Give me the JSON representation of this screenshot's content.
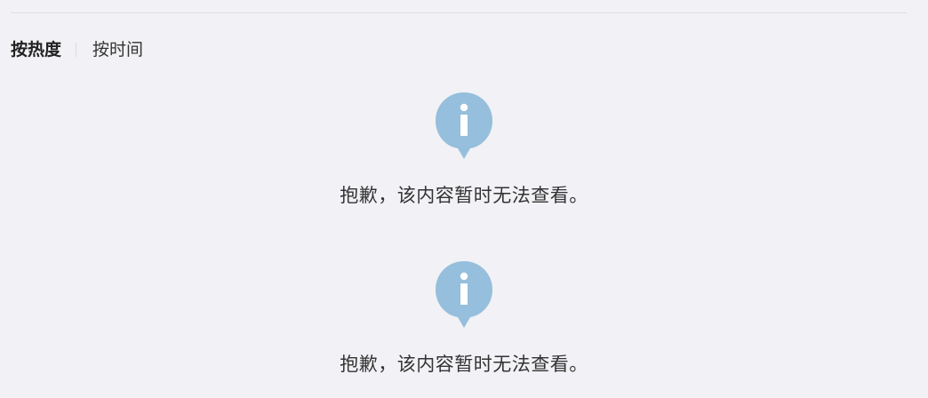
{
  "sort": {
    "tabs": [
      {
        "label": "按热度",
        "active": true
      },
      {
        "label": "按时间",
        "active": false
      }
    ]
  },
  "notices": [
    {
      "icon": "info-icon",
      "text": "抱歉，该内容暂时无法查看。"
    },
    {
      "icon": "info-icon",
      "text": "抱歉，该内容暂时无法查看。"
    }
  ],
  "colors": {
    "background": "#f2f1f5",
    "icon": "#95bfdc",
    "text": "#333333"
  }
}
